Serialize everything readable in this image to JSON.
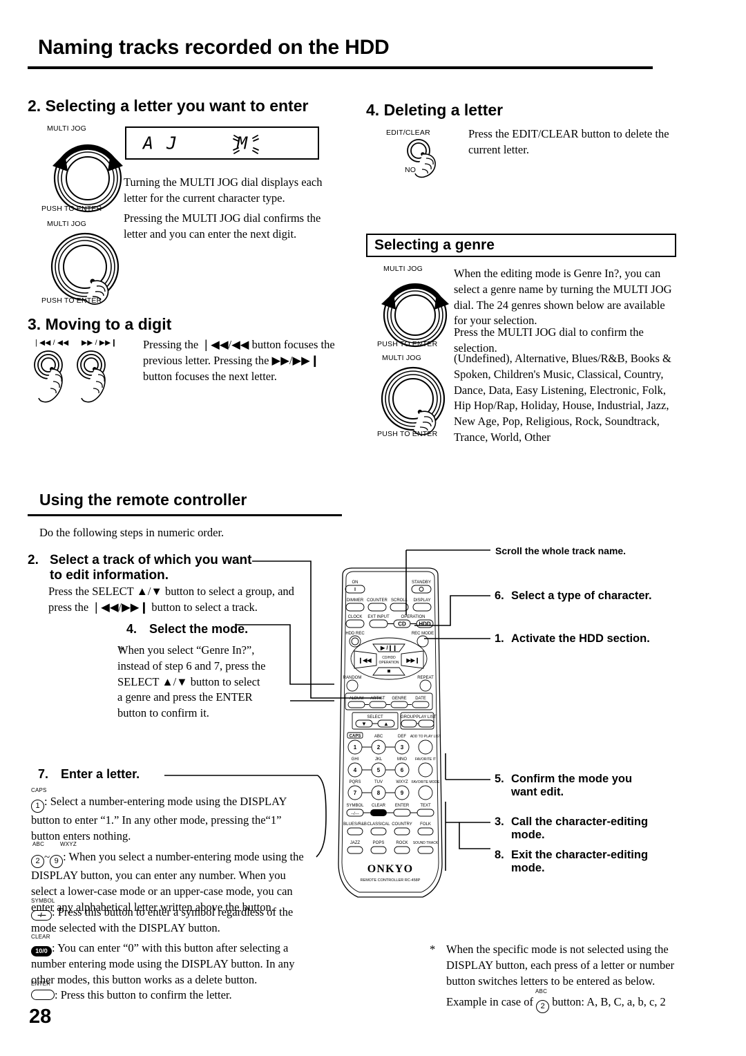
{
  "page": {
    "title": "Naming tracks recorded on the HDD",
    "number": "28"
  },
  "section2": {
    "heading": "2. Selecting a letter you want to enter",
    "dial_label_1": "MULTI JOG",
    "push_label_1": "PUSH TO ENTER",
    "dial_label_2": "MULTI JOG",
    "push_label_2": "PUSH TO ENTER",
    "display": {
      "left_text": "A J",
      "right_text": "M"
    },
    "paragraph_1": "Turning the MULTI JOG dial displays each letter for the current character type.",
    "paragraph_2": "Pressing the MULTI JOG dial confirms the letter and you can enter the next digit."
  },
  "section3": {
    "heading": "3. Moving to a digit",
    "button_label_left": "❘◀◀ / ◀◀",
    "button_label_right": "▶▶ / ▶▶❙",
    "paragraph": "Pressing the ❘◀◀/◀◀ button focuses the previous letter. Pressing the ▶▶/▶▶❙ button focuses the next letter."
  },
  "section4": {
    "heading": "4. Deleting a letter",
    "button_top_label": "EDIT/CLEAR",
    "button_bottom_label": "NO",
    "paragraph": "Press the EDIT/CLEAR button to delete the current letter."
  },
  "genre": {
    "box_title": "Selecting a genre",
    "dial_label_1": "MULTI JOG",
    "push_label_1": "PUSH TO ENTER",
    "dial_label_2": "MULTI JOG",
    "push_label_2": "PUSH TO ENTER",
    "paragraph_1": "When the editing mode is Genre In?, you can select a genre name by turning the MULTI JOG dial. The 24 genres shown below are available for your selection.",
    "paragraph_2": "Press the MULTI JOG dial to confirm the selection.",
    "list": "(Undefined), Alternative, Blues/R&B, Books & Spoken, Children's Music, Classical, Country, Dance, Data, Easy Listening, Electronic, Folk, Hip Hop/Rap, Holiday, House, Industrial, Jazz, New Age, Pop, Religious, Rock, Soundtrack, Trance, World, Other"
  },
  "remote_section": {
    "heading": "Using the remote controller",
    "intro": "Do the following steps in numeric order.",
    "step2": {
      "number": "2.",
      "title": "Select a track of which you want to edit information.",
      "body": "Press the SELECT ▲/▼ button to select a group, and press the ❘◀◀/▶▶❙ button to select a track."
    },
    "step4": {
      "number": "4.",
      "title": "Select the mode.",
      "star": "*",
      "note": "When you select “Genre In?”, instead of step 6 and 7, press the SELECT ▲/▼ button to select a genre and press the ENTER button to confirm it."
    },
    "step7": {
      "number": "7.",
      "title": "Enter a letter.",
      "bullets": [
        {
          "cap": "CAPS",
          "key": "1",
          "key_type": "circle",
          "text": ": Select a number-entering mode using the DISPLAY button to enter “1.” In any other mode, pressing the“1” button enters nothing."
        },
        {
          "cap_left": "ABC",
          "cap_right": "WXYZ",
          "key_left": "2",
          "key_right": "9",
          "key_type": "range",
          "text": ": When you select a number-entering mode using the DISPLAY button, you can enter any number. When you select a lower-case mode or an upper-case mode, you can enter any alphabetical letter written above the button."
        },
        {
          "cap": "SYMBOL",
          "key": "--/---",
          "key_type": "oval",
          "text": ": Press this button to enter a symbol regardless of the mode selected with the DISPLAY button."
        },
        {
          "cap": "CLEAR",
          "key": "10/0",
          "key_type": "oval-filled",
          "text": ": You can enter “0” with this button after selecting a number entering mode using the DISPLAY button. In any other modes, this button works as a delete button."
        },
        {
          "cap": "ENTER",
          "key": "",
          "key_type": "oval-plain",
          "text": ": Press this button to confirm the letter."
        }
      ]
    }
  },
  "callouts": {
    "scroll": "Scroll the whole track name.",
    "step6": {
      "number": "6.",
      "text": "Select a type of character."
    },
    "step1": {
      "number": "1.",
      "text": "Activate the HDD section."
    },
    "step5": {
      "number": "5.",
      "text": "Confirm the mode you want edit."
    },
    "step3": {
      "number": "3.",
      "text": "Call the character-editing mode."
    },
    "step8": {
      "number": "8.",
      "text": "Exit the character-editing mode."
    }
  },
  "footnote": {
    "star": "*",
    "text": "When the specific mode is not selected using the DISPLAY button, each press of a letter or number button switches letters to be entered as below.",
    "example_prefix": "Example  in case of",
    "example_cap": "ABC",
    "example_key": "2",
    "example_suffix": "button: A, B, C, a, b, c, 2"
  },
  "remote_device": {
    "brand": "ONKYO",
    "model_line": "REMOTE CONTROLLER     RC-458P",
    "buttons": [
      "ON",
      "STANDBY",
      "DIMMER",
      "COUNTER",
      "SCROLL",
      "DISPLAY",
      "CLOCK",
      "EXT INPUT",
      "OPERATION",
      "CD",
      "HDD",
      "HDD REC",
      "REC MODE",
      "CD/HDD OPERATION",
      "RANDOM",
      "REPEAT",
      "ALBUM",
      "ARTIST",
      "GENRE",
      "DATE",
      "SELECT",
      "GROUP",
      "PLAY LIST",
      "CAPS",
      "ABC",
      "DEF",
      "ADD TO PLAY LIST",
      "GHI",
      "JKL",
      "MNO",
      "FAVORITE IT",
      "PQRS",
      "TUV",
      "WXYZ",
      "FAVORITE MODE",
      "SYMBOL",
      "CLEAR",
      "ENTER",
      "TEXT",
      "BLUES/R&B",
      "CLASSICAL",
      "COUNTRY",
      "FOLK",
      "JAZZ",
      "POPS",
      "ROCK",
      "SOUND TRACK"
    ]
  },
  "colors": {
    "ink": "#000000",
    "paper": "#ffffff"
  }
}
